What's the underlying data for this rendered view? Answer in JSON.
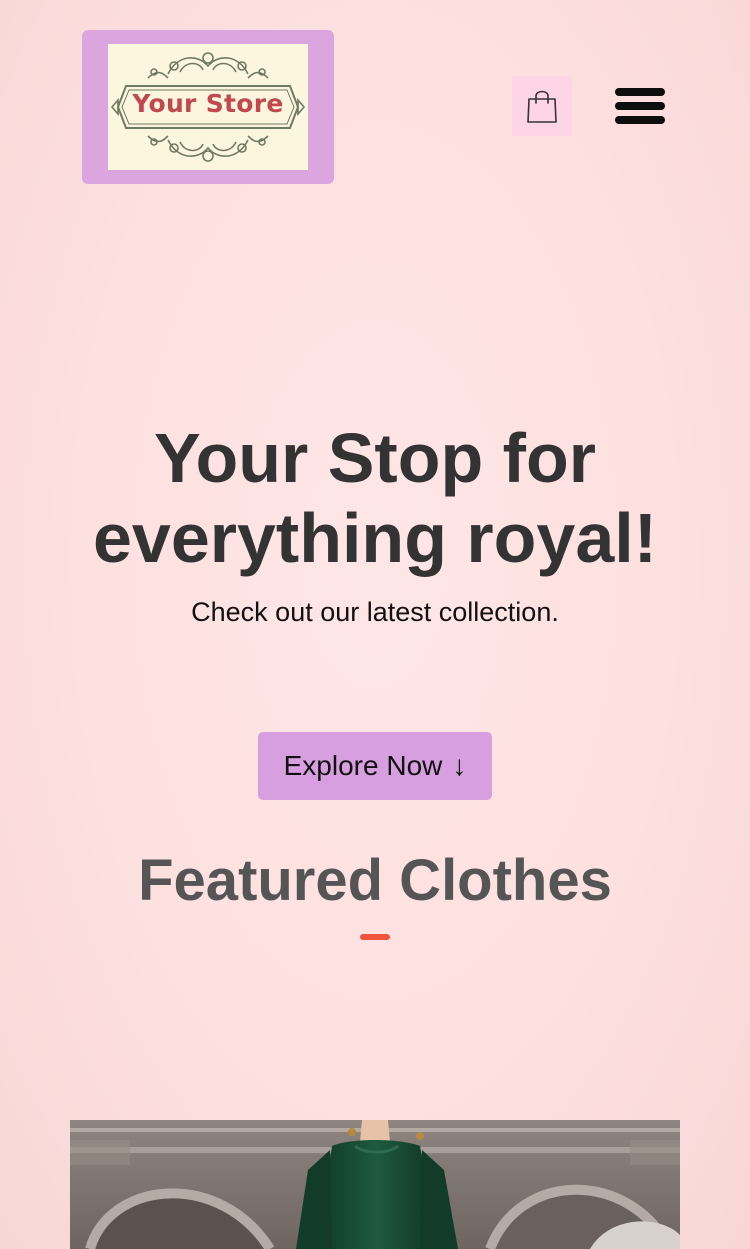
{
  "header": {
    "logo_text": "Your Store",
    "cart_icon": "shopping-bag-icon",
    "menu_icon": "hamburger-menu-icon"
  },
  "hero": {
    "title_line1": "Your Stop for",
    "title_line2": "everything royal!",
    "subtitle": "Check out our latest collection.",
    "cta_label": "Explore Now",
    "cta_arrow": "↓"
  },
  "featured": {
    "title": "Featured Clothes"
  },
  "colors": {
    "background": "#fde2e2",
    "logo_box": "#dba6e0",
    "cart_bg": "#fdd5e7",
    "cta_bg": "#d79fdf",
    "accent": "#f0543f",
    "logo_text": "#c2484f"
  }
}
